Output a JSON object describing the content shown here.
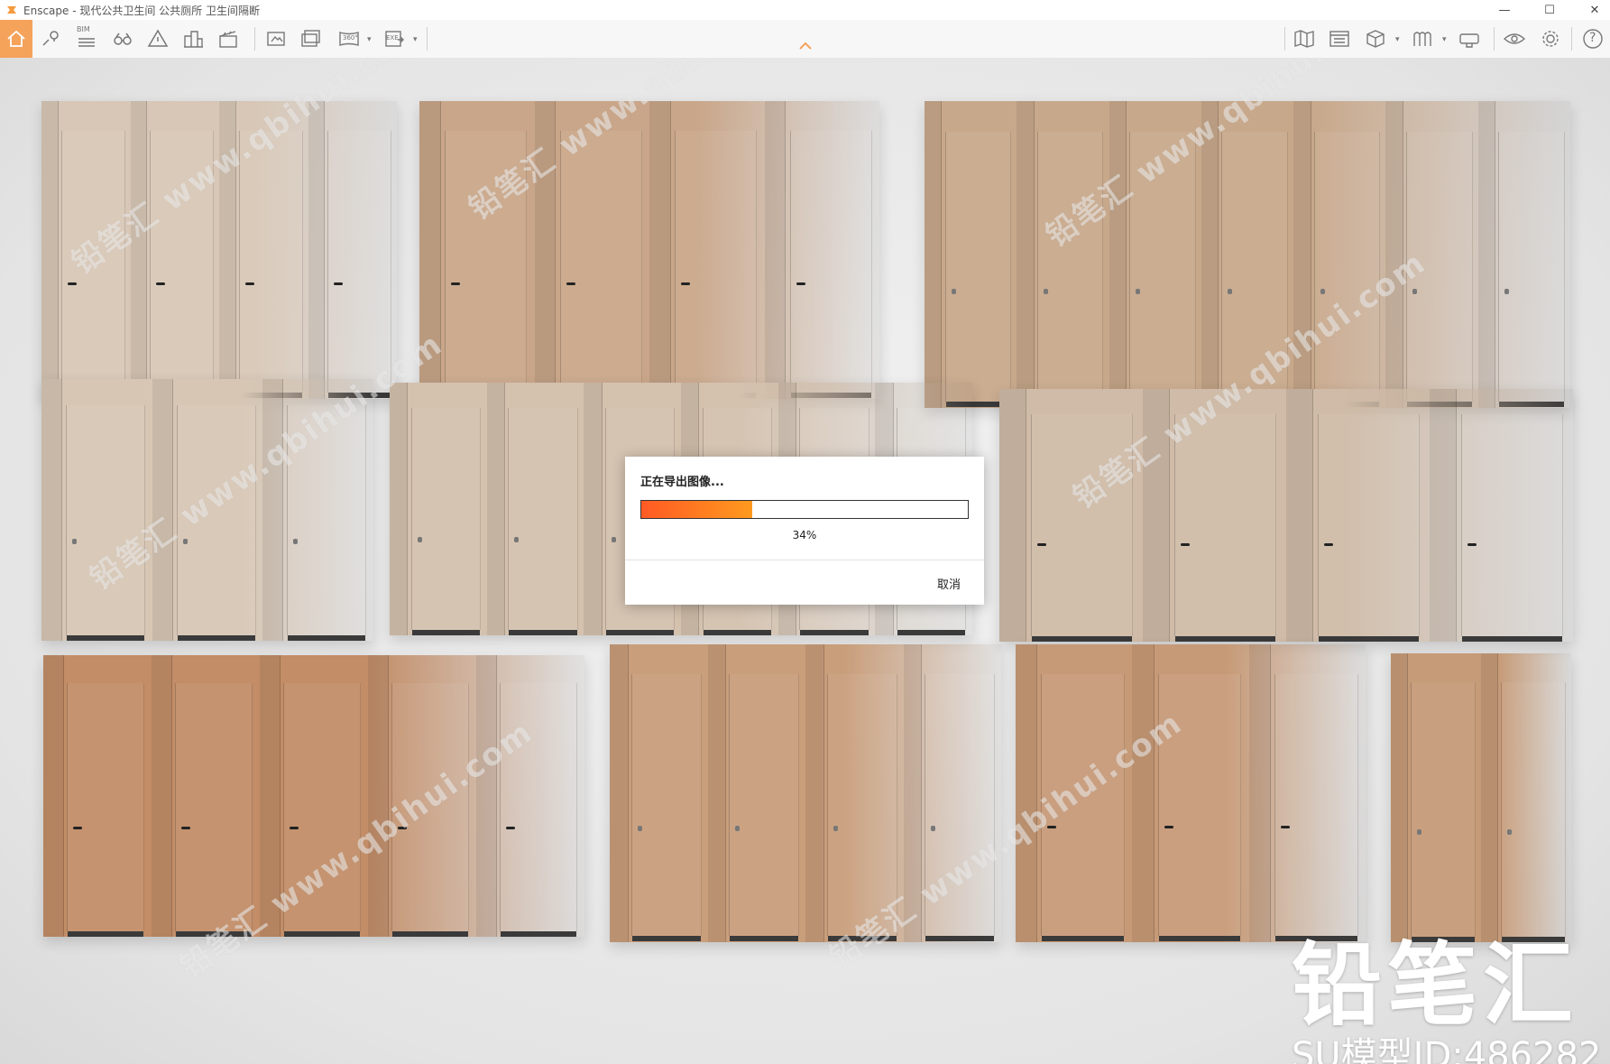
{
  "window": {
    "title": "Enscape - 现代公共卫生间 公共厕所 卫生间隔断",
    "minimize": "—",
    "maximize": "☐",
    "close": "✕"
  },
  "toolbar": {
    "bim_label": "BIM",
    "pano_label": "360°",
    "exe_label": "EXE",
    "help_label": "?",
    "accent": "#f5a25b",
    "left_icons": [
      "home-icon",
      "location-icon",
      "bim-icon",
      "binoculars-icon",
      "warning-icon",
      "buildings-icon",
      "clapper-icon",
      "screenshot-icon",
      "batch-render-icon",
      "panorama-icon",
      "export-exe-icon"
    ],
    "right_icons": [
      "map-icon",
      "sync-views-icon",
      "asset-library-icon",
      "material-icon",
      "vr-headset-icon",
      "visual-settings-icon",
      "settings-icon",
      "help-icon"
    ]
  },
  "dialog": {
    "title": "正在导出图像...",
    "progress": 0.34,
    "percent_label": "34%",
    "cancel_label": "取消",
    "fill_start": "#ff5a24",
    "fill_end": "#ff9a1e"
  },
  "watermark": {
    "brand": "铅笔汇",
    "model_id": "SU模型ID:486282"
  }
}
